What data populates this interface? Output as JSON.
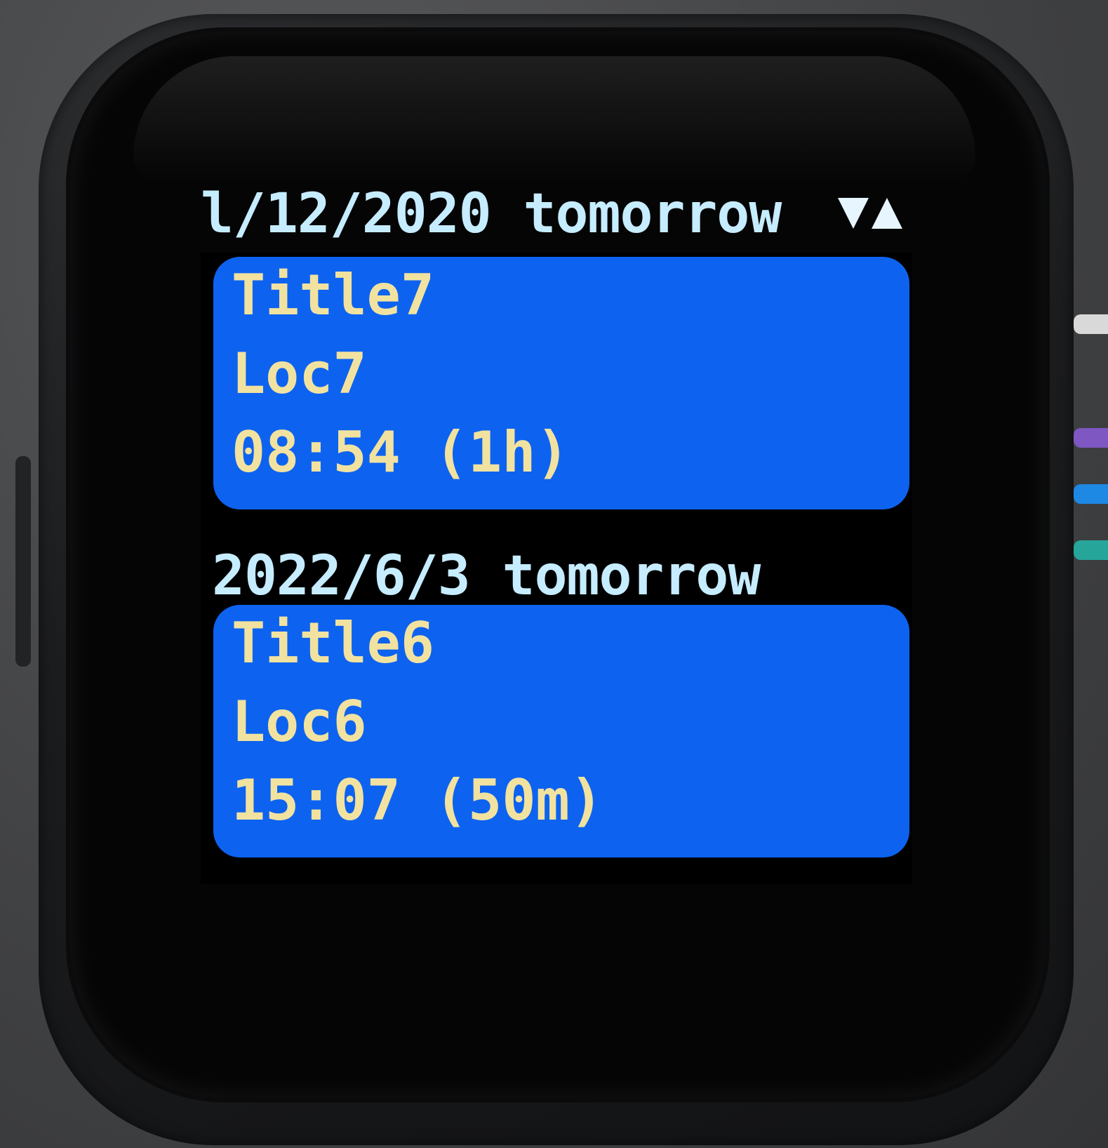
{
  "header": {
    "date_label": "l/12/2020 tomorrow",
    "scroll_down_icon": "triangle-down-icon",
    "scroll_up_icon": "triangle-up-icon"
  },
  "events": [
    {
      "title": "Title7",
      "location": "Loc7",
      "time": "08:54 (1h)"
    },
    {
      "title": "Title6",
      "location": "Loc6",
      "time": "15:07 (50m)"
    }
  ],
  "sections": [
    {
      "date_label": "2022/6/3 tomorrow"
    }
  ],
  "colors": {
    "card_blue": "#0d63f0",
    "event_text": "#f2e2a0",
    "date_text": "#c6ecff",
    "screen_bg": "#000000"
  }
}
